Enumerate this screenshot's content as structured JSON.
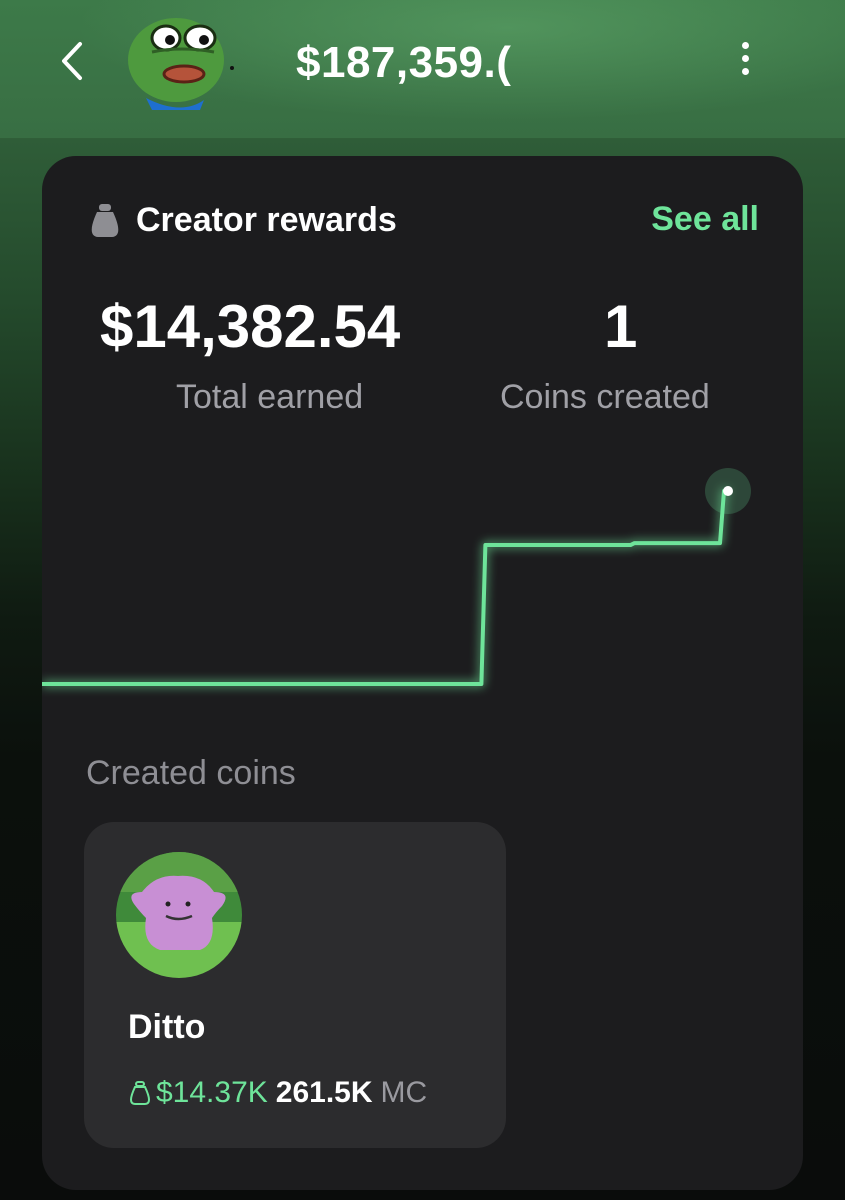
{
  "header": {
    "balance": "$187,359.(",
    "icons": {
      "back": "chevron-left-icon",
      "more": "more-vertical-icon",
      "avatar": "pepe-frog-avatar"
    }
  },
  "rewards": {
    "title": "Creator rewards",
    "see_all": "See all",
    "total_earned_value": "$14,382.54",
    "total_earned_label": "Total earned",
    "coins_created_value": "1",
    "coins_created_label": "Coins created",
    "icon": "money-bag-icon"
  },
  "chart_data": {
    "type": "line",
    "series": [
      {
        "values": [
          0,
          0,
          0,
          0,
          0,
          0,
          0,
          0,
          0,
          0,
          0,
          0,
          0,
          0,
          0,
          0.72,
          0.72,
          0.72,
          0.72,
          0.72,
          0.73,
          0.73,
          0.73,
          1.0
        ]
      }
    ],
    "xlabel": "",
    "ylabel": "",
    "grid": false,
    "color": "#6ee49a"
  },
  "created_coins": {
    "label": "Created coins",
    "coins": [
      {
        "name": "Ditto",
        "earned": "$14.37K",
        "market_cap": "261.5K",
        "mc_unit": "MC",
        "icon": "ditto-avatar"
      }
    ]
  },
  "colors": {
    "accent": "#6ee49a",
    "card": "#1c1c1e",
    "inner_card": "#2c2c2e",
    "header_green": "#3d7a49"
  }
}
